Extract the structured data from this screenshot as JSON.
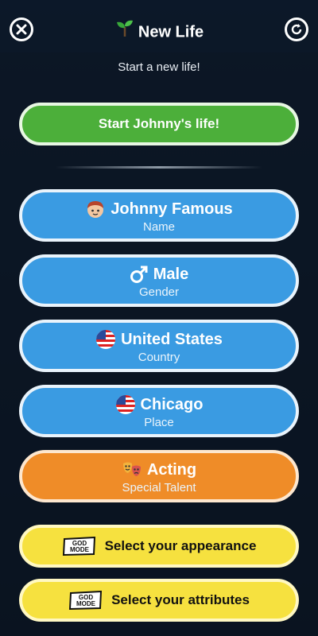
{
  "header": {
    "title": "New Life",
    "close_icon": "close-icon",
    "refresh_icon": "refresh-icon"
  },
  "subtitle": "Start a new life!",
  "start_button": "Start Johnny's life!",
  "options": [
    {
      "key": "name",
      "value": "Johnny Famous",
      "label": "Name",
      "color": "#3a9be2",
      "icon": "face-icon"
    },
    {
      "key": "gender",
      "value": "Male",
      "label": "Gender",
      "color": "#3a9be2",
      "icon": "male-icon"
    },
    {
      "key": "country",
      "value": "United States",
      "label": "Country",
      "color": "#3a9be2",
      "icon": "us-flag-icon"
    },
    {
      "key": "place",
      "value": "Chicago",
      "label": "Place",
      "color": "#3a9be2",
      "icon": "us-flag-icon"
    },
    {
      "key": "talent",
      "value": "Acting",
      "label": "Special Talent",
      "color": "#ef8c28",
      "icon": "theater-masks-icon"
    }
  ],
  "god_mode": {
    "badge_text": "GOD MODE",
    "appearance": "Select your appearance",
    "attributes": "Select your attributes"
  }
}
